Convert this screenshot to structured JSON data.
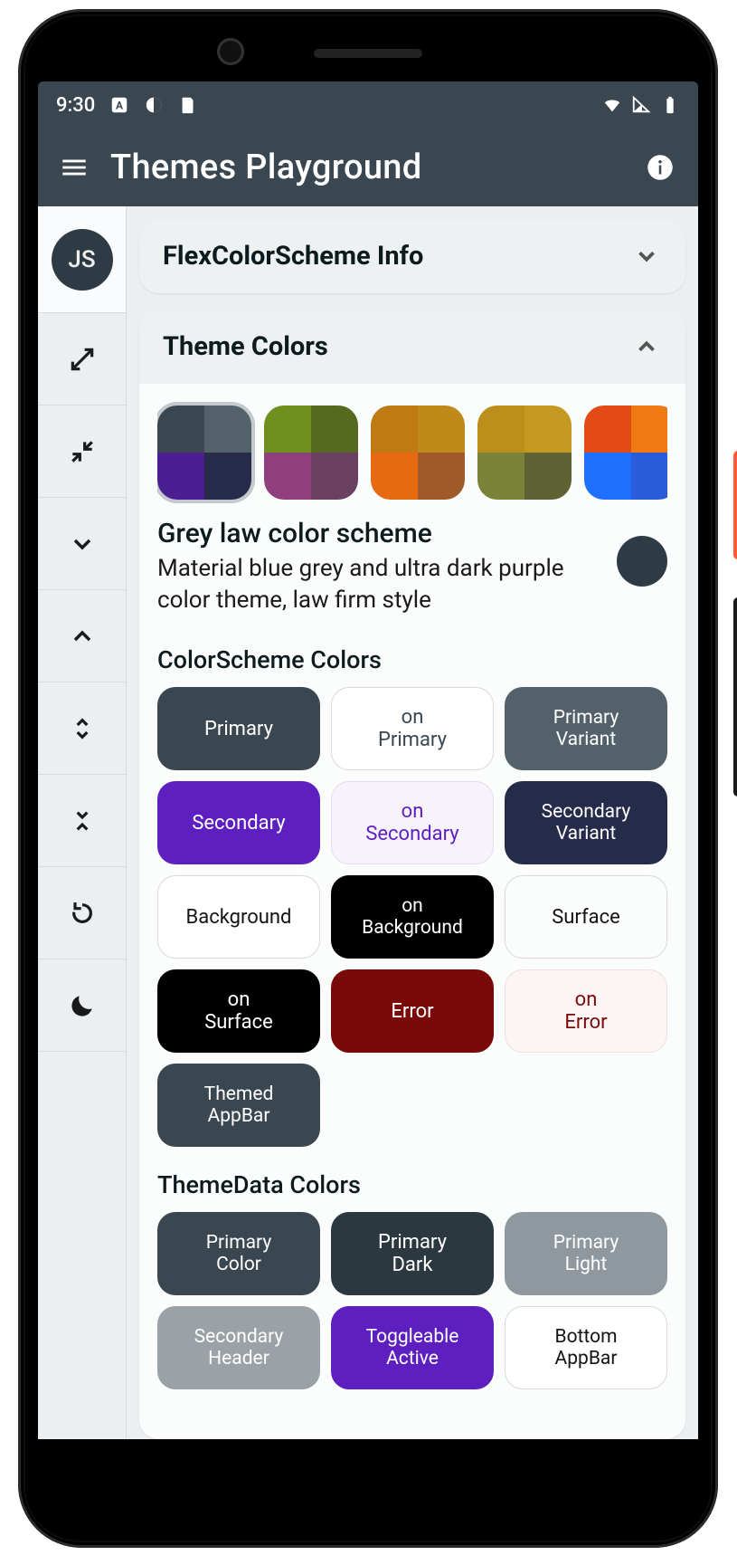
{
  "status": {
    "time": "9:30"
  },
  "appbar": {
    "title": "Themes Playground"
  },
  "sidebar": {
    "avatar": "JS"
  },
  "cards": {
    "info": {
      "title": "FlexColorScheme Info"
    },
    "theme": {
      "title": "Theme Colors"
    }
  },
  "scheme": {
    "title": "Grey law color scheme",
    "desc": "Material blue grey and ultra dark purple color theme, law firm style"
  },
  "sections": {
    "colorscheme": "ColorScheme Colors",
    "themedata": "ThemeData Colors"
  },
  "swatches": [
    {
      "selected": true,
      "tl": "#3a4750",
      "tr": "#53616b",
      "bl": "#4b1f92",
      "br": "#272b4a"
    },
    {
      "selected": false,
      "tl": "#6f8f1f",
      "tr": "#556a1f",
      "bl": "#8f3f7b",
      "br": "#6a4063"
    },
    {
      "selected": false,
      "tl": "#c07a14",
      "tr": "#c08a1a",
      "bl": "#e76a12",
      "br": "#a05a2a"
    },
    {
      "selected": false,
      "tl": "#bb8f1a",
      "tr": "#c49a20",
      "bl": "#7a833a",
      "br": "#5f6233"
    },
    {
      "selected": false,
      "tl": "#e24a16",
      "tr": "#f07a12",
      "bl": "#1f6fff",
      "br": "#2a5bd9"
    }
  ],
  "chips": {
    "colorscheme": [
      {
        "label": "Primary",
        "bg": "#3a4750",
        "fg": "#ffffff"
      },
      {
        "label": "on Primary",
        "bg": "#ffffff",
        "fg": "#3a4750",
        "border": "#d9d9d9"
      },
      {
        "label": "Primary Variant",
        "bg": "#53616b",
        "fg": "#ffffff"
      },
      {
        "label": "Secondary",
        "bg": "#5d1fc0",
        "fg": "#ffffff"
      },
      {
        "label": "on Secondary",
        "bg": "#f7f3fc",
        "fg": "#5d1fc0",
        "border": "#e6dcf3"
      },
      {
        "label": "Secondary Variant",
        "bg": "#272b4a",
        "fg": "#ffffff"
      },
      {
        "label": "Background",
        "bg": "#ffffff",
        "fg": "#141414",
        "border": "#d9d9d9"
      },
      {
        "label": "on Background",
        "bg": "#000000",
        "fg": "#ffffff"
      },
      {
        "label": "Surface",
        "bg": "#fbfcfc",
        "fg": "#141414",
        "border": "#d9d9d9"
      },
      {
        "label": "on Surface",
        "bg": "#000000",
        "fg": "#ffffff"
      },
      {
        "label": "Error",
        "bg": "#7a0a0a",
        "fg": "#ffffff"
      },
      {
        "label": "on Error",
        "bg": "#fdf5f4",
        "fg": "#7a0a0a",
        "border": "#f0e0de"
      },
      {
        "label": "Themed AppBar",
        "bg": "#3a4750",
        "fg": "#ffffff"
      }
    ],
    "themedata": [
      {
        "label": "Primary Color",
        "bg": "#3a4750",
        "fg": "#ffffff"
      },
      {
        "label": "Primary Dark",
        "bg": "#2b3840",
        "fg": "#ffffff"
      },
      {
        "label": "Primary Light",
        "bg": "#8f989e",
        "fg": "#ffffff"
      },
      {
        "label": "Secondary Header",
        "bg": "#9aa2a7",
        "fg": "#ffffff"
      },
      {
        "label": "Toggleable Active",
        "bg": "#5d1fc0",
        "fg": "#ffffff"
      },
      {
        "label": "Bottom AppBar",
        "bg": "#ffffff",
        "fg": "#141414",
        "border": "#d9d9d9"
      }
    ]
  }
}
